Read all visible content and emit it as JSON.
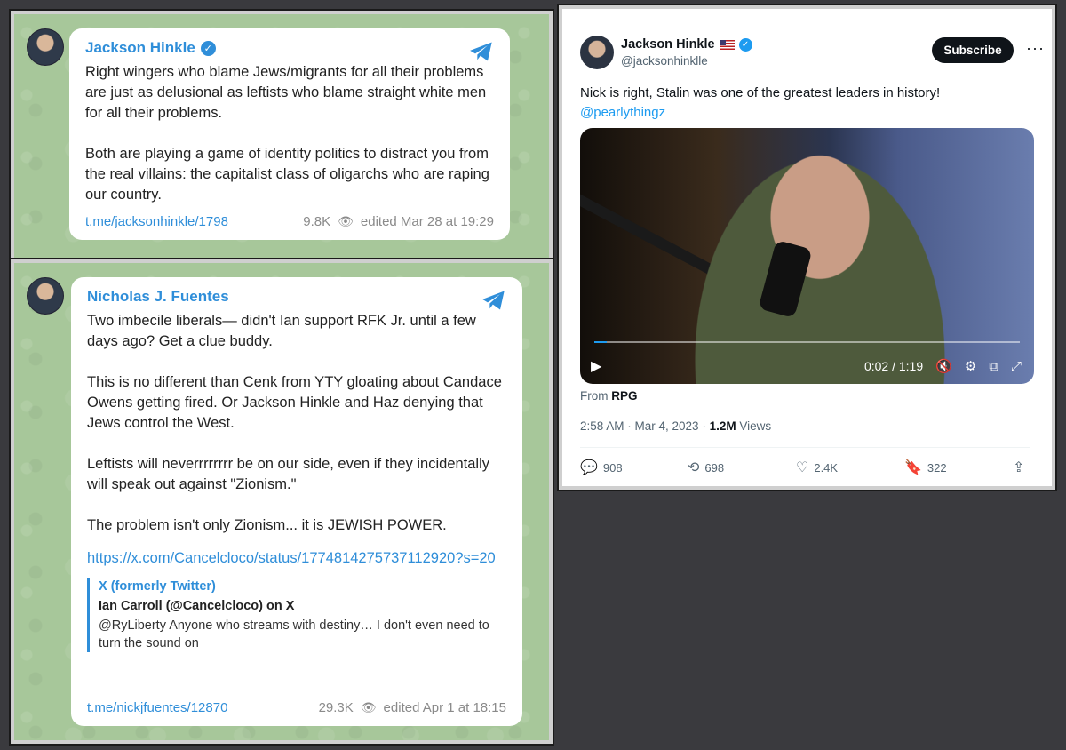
{
  "telegram_post_1": {
    "author": "Jackson Hinkle",
    "text": "Right wingers who blame Jews/migrants for all their problems are just as delusional as leftists who blame straight white men for all their problems.\n\nBoth are playing a game of identity politics to distract you from the real villains: the capitalist class of oligarchs who are raping our country.",
    "link": "t.me/jacksonhinkle/1798",
    "views": "9.8K",
    "edited": "edited  Mar 28 at 19:29"
  },
  "telegram_post_2": {
    "author": "Nicholas J. Fuentes",
    "text": "Two imbecile liberals— didn't Ian support RFK Jr. until a few days ago? Get a clue buddy.\n\nThis is no different than Cenk from YTY gloating about Candace Owens getting fired. Or Jackson Hinkle and Haz denying that Jews control the West.\n\nLeftists will neverrrrrrrr be on our side, even if they incidentally will speak out against \"Zionism.\"\n\nThe problem isn't only Zionism... it is JEWISH POWER.",
    "url": "https://x.com/Cancelcloco/status/1774814275737112920?s=20",
    "preview": {
      "source": "X (formerly Twitter)",
      "title": "Ian Carroll (@Cancelcloco) on X",
      "body": "@RyLiberty Anyone who streams with destiny… I don't even need to turn the sound on"
    },
    "link": "t.me/nickjfuentes/12870",
    "views": "29.3K",
    "edited": "edited  Apr 1 at 18:15"
  },
  "tweet": {
    "name": "Jackson Hinkle",
    "handle": "@jacksonhinklle",
    "subscribe_label": "Subscribe",
    "more_label": "···",
    "text": "Nick is right, Stalin was one of the greatest leaders in history!",
    "mention": "@pearlythingz",
    "video": {
      "time": "0:02 / 1:19",
      "progress": 0.03
    },
    "from_label": "From",
    "from_source": "RPG",
    "timestamp": "2:58 AM · Mar 4, 2023 · ",
    "views_count": "1.2M",
    "views_label": " Views",
    "replies": "908",
    "reposts": "698",
    "likes": "2.4K",
    "bookmarks": "322"
  }
}
